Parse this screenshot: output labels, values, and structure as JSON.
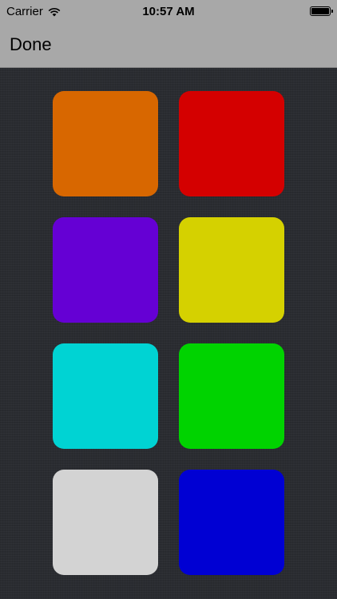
{
  "status_bar": {
    "carrier": "Carrier",
    "time": "10:57 AM",
    "wifi_icon": "wifi-icon",
    "battery_icon": "battery-icon"
  },
  "nav_bar": {
    "done_label": "Done"
  },
  "swatches": [
    {
      "name": "orange",
      "color": "#d86700"
    },
    {
      "name": "red",
      "color": "#d40000"
    },
    {
      "name": "purple",
      "color": "#6500d4"
    },
    {
      "name": "yellow",
      "color": "#d5d100"
    },
    {
      "name": "cyan",
      "color": "#00d3d3"
    },
    {
      "name": "green",
      "color": "#00d300"
    },
    {
      "name": "light-gray",
      "color": "#d3d3d3"
    },
    {
      "name": "blue",
      "color": "#0000d3"
    }
  ]
}
